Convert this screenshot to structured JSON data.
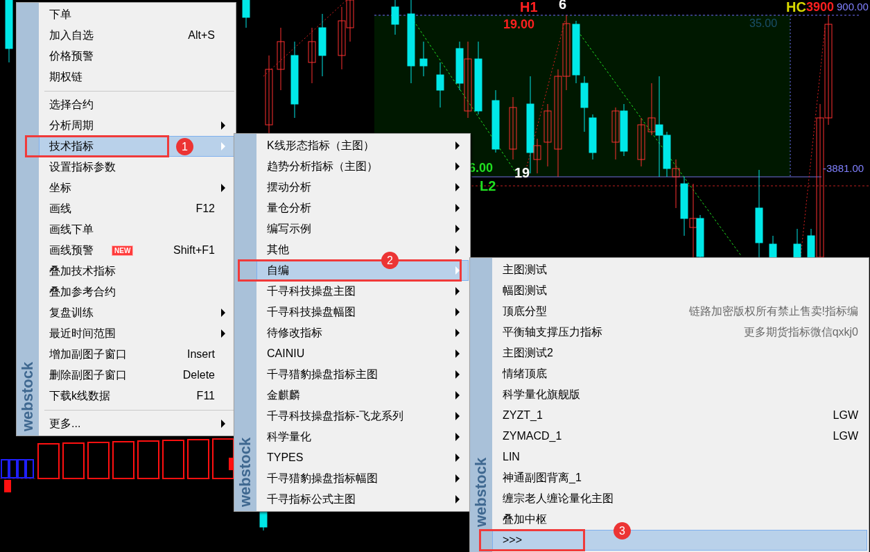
{
  "chart": {
    "labels": [
      {
        "text": "H1",
        "kind": "high"
      },
      {
        "text": "6",
        "kind": "count"
      },
      {
        "text": "19.00",
        "kind": "high_price"
      },
      {
        "text": "35.00",
        "kind": "box_value"
      },
      {
        "text": "HC",
        "kind": "tag"
      },
      {
        "text": "3900",
        "kind": "high_price"
      },
      {
        "text": "900.00",
        "kind": "axis_price"
      },
      {
        "text": "6.00",
        "kind": "low_price"
      },
      {
        "text": "L2",
        "kind": "low"
      },
      {
        "text": "19",
        "kind": "count"
      },
      {
        "text": "-3881.00",
        "kind": "axis_price"
      }
    ]
  },
  "menus": [
    {
      "logo": "webstock",
      "items": [
        {
          "kind": "item",
          "label": "下单",
          "submenu": false,
          "selected": false
        },
        {
          "kind": "item",
          "label": "加入自选",
          "shortcut": "Alt+S",
          "submenu": false,
          "selected": false
        },
        {
          "kind": "item",
          "label": "价格预警",
          "submenu": false,
          "selected": false
        },
        {
          "kind": "item",
          "label": "期权链",
          "submenu": false,
          "selected": false
        },
        {
          "kind": "separator"
        },
        {
          "kind": "item",
          "label": "选择合约",
          "submenu": false,
          "selected": false
        },
        {
          "kind": "item",
          "label": "分析周期",
          "submenu": true,
          "selected": false
        },
        {
          "kind": "item",
          "label": "技术指标",
          "submenu": true,
          "selected": true,
          "callout": "1"
        },
        {
          "kind": "item",
          "label": "设置指标参数",
          "submenu": false,
          "selected": false
        },
        {
          "kind": "item",
          "label": "坐标",
          "submenu": true,
          "selected": false
        },
        {
          "kind": "item",
          "label": "画线",
          "shortcut": "F12",
          "submenu": false,
          "selected": false
        },
        {
          "kind": "item",
          "label": "画线下单",
          "submenu": false,
          "selected": false
        },
        {
          "kind": "item",
          "label": "画线预警",
          "badge": "NEW",
          "shortcut": "Shift+F1",
          "submenu": false,
          "selected": false
        },
        {
          "kind": "item",
          "label": "叠加技术指标",
          "submenu": false,
          "selected": false
        },
        {
          "kind": "item",
          "label": "叠加参考合约",
          "submenu": false,
          "selected": false
        },
        {
          "kind": "item",
          "label": "复盘训练",
          "submenu": true,
          "selected": false
        },
        {
          "kind": "item",
          "label": "最近时间范围",
          "submenu": true,
          "selected": false
        },
        {
          "kind": "item",
          "label": "增加副图子窗口",
          "shortcut": "Insert",
          "submenu": false,
          "selected": false
        },
        {
          "kind": "item",
          "label": "删除副图子窗口",
          "shortcut": "Delete",
          "submenu": false,
          "selected": false
        },
        {
          "kind": "item",
          "label": "下载k线数据",
          "shortcut": "F11",
          "submenu": false,
          "selected": false
        },
        {
          "kind": "separator"
        },
        {
          "kind": "item",
          "label": "更多...",
          "submenu": true,
          "selected": false
        }
      ]
    },
    {
      "logo": "webstock",
      "items": [
        {
          "kind": "item",
          "label": "K线形态指标（主图）",
          "submenu": true,
          "selected": false
        },
        {
          "kind": "item",
          "label": "趋势分析指标（主图）",
          "submenu": true,
          "selected": false
        },
        {
          "kind": "item",
          "label": "摆动分析",
          "submenu": true,
          "selected": false
        },
        {
          "kind": "item",
          "label": "量仓分析",
          "submenu": true,
          "selected": false
        },
        {
          "kind": "item",
          "label": "编写示例",
          "submenu": true,
          "selected": false
        },
        {
          "kind": "item",
          "label": "其他",
          "submenu": true,
          "selected": false
        },
        {
          "kind": "item",
          "label": "自编",
          "submenu": true,
          "selected": true,
          "callout": "2"
        },
        {
          "kind": "item",
          "label": "千寻科技操盘主图",
          "submenu": true,
          "selected": false
        },
        {
          "kind": "item",
          "label": "千寻科技操盘幅图",
          "submenu": true,
          "selected": false
        },
        {
          "kind": "item",
          "label": "待修改指标",
          "submenu": true,
          "selected": false
        },
        {
          "kind": "item",
          "label": "CAINIU",
          "submenu": true,
          "selected": false
        },
        {
          "kind": "item",
          "label": "千寻猎豹操盘指标主图",
          "submenu": true,
          "selected": false
        },
        {
          "kind": "item",
          "label": "金麒麟",
          "submenu": true,
          "selected": false
        },
        {
          "kind": "item",
          "label": "千寻科技操盘指标-飞龙系列",
          "submenu": true,
          "selected": false
        },
        {
          "kind": "item",
          "label": "科学量化",
          "submenu": true,
          "selected": false
        },
        {
          "kind": "item",
          "label": "TYPES",
          "submenu": true,
          "selected": false
        },
        {
          "kind": "item",
          "label": "千寻猎豹操盘指标幅图",
          "submenu": true,
          "selected": false
        },
        {
          "kind": "item",
          "label": "千寻指标公式主图",
          "submenu": true,
          "selected": false
        }
      ]
    },
    {
      "logo": "webstock",
      "items": [
        {
          "kind": "item",
          "label": "主图测试",
          "selected": false
        },
        {
          "kind": "item",
          "label": "幅图测试",
          "selected": false
        },
        {
          "kind": "item",
          "label": "顶底分型",
          "shortcut": "链路加密版权所有禁止售卖!指标编",
          "muted": true,
          "selected": false
        },
        {
          "kind": "item",
          "label": "平衡轴支撑压力指标",
          "shortcut": "更多期货指标微信qxkj0",
          "muted": true,
          "selected": false
        },
        {
          "kind": "item",
          "label": "主图测试2",
          "selected": false
        },
        {
          "kind": "item",
          "label": "情绪顶底",
          "selected": false
        },
        {
          "kind": "item",
          "label": "科学量化旗舰版",
          "selected": false
        },
        {
          "kind": "item",
          "label": "ZYZT_1",
          "shortcut": "LGW",
          "muted": false,
          "selected": false
        },
        {
          "kind": "item",
          "label": "ZYMACD_1",
          "shortcut": "LGW",
          "muted": false,
          "selected": false
        },
        {
          "kind": "item",
          "label": "LIN",
          "selected": false
        },
        {
          "kind": "item",
          "label": "神通副图背离_1",
          "selected": false
        },
        {
          "kind": "item",
          "label": "缠宗老人缠论量化主图",
          "selected": false
        },
        {
          "kind": "item",
          "label": "叠加中枢",
          "selected": false
        },
        {
          "kind": "item",
          "label": ">>>",
          "selected": true,
          "callout": "3"
        }
      ]
    }
  ]
}
